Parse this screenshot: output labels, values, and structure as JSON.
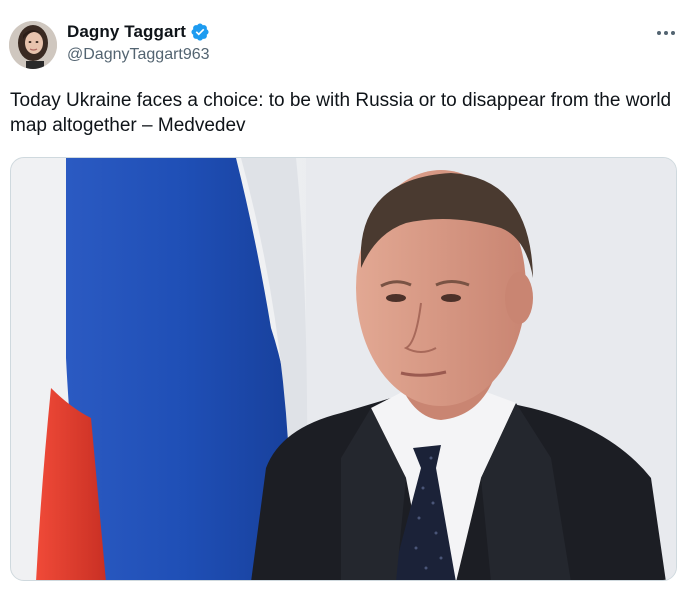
{
  "tweet": {
    "author": {
      "display_name": "Dagny Taggart",
      "handle": "@DagnyTaggart963",
      "verified_icon": "verified-badge-icon",
      "avatar_icon": "avatar"
    },
    "more_icon": "more-options-icon",
    "text": "Today Ukraine faces a choice: to be with Russia or to disappear from the world map altogether – Medvedev",
    "media": {
      "icon": "photo-media",
      "colors": {
        "flag_white": "#f2f2f2",
        "flag_blue": "#1f4fb6",
        "flag_red": "#e53b2c",
        "background": "#e6e8ec",
        "suit": "#1c1e24",
        "tie": "#1b2238",
        "shirt": "#f4f4f6",
        "skin": "#d99a84"
      }
    },
    "colors": {
      "verified": "#1d9bf0",
      "secondary_text": "#536471",
      "primary_text": "#0f1419"
    }
  }
}
